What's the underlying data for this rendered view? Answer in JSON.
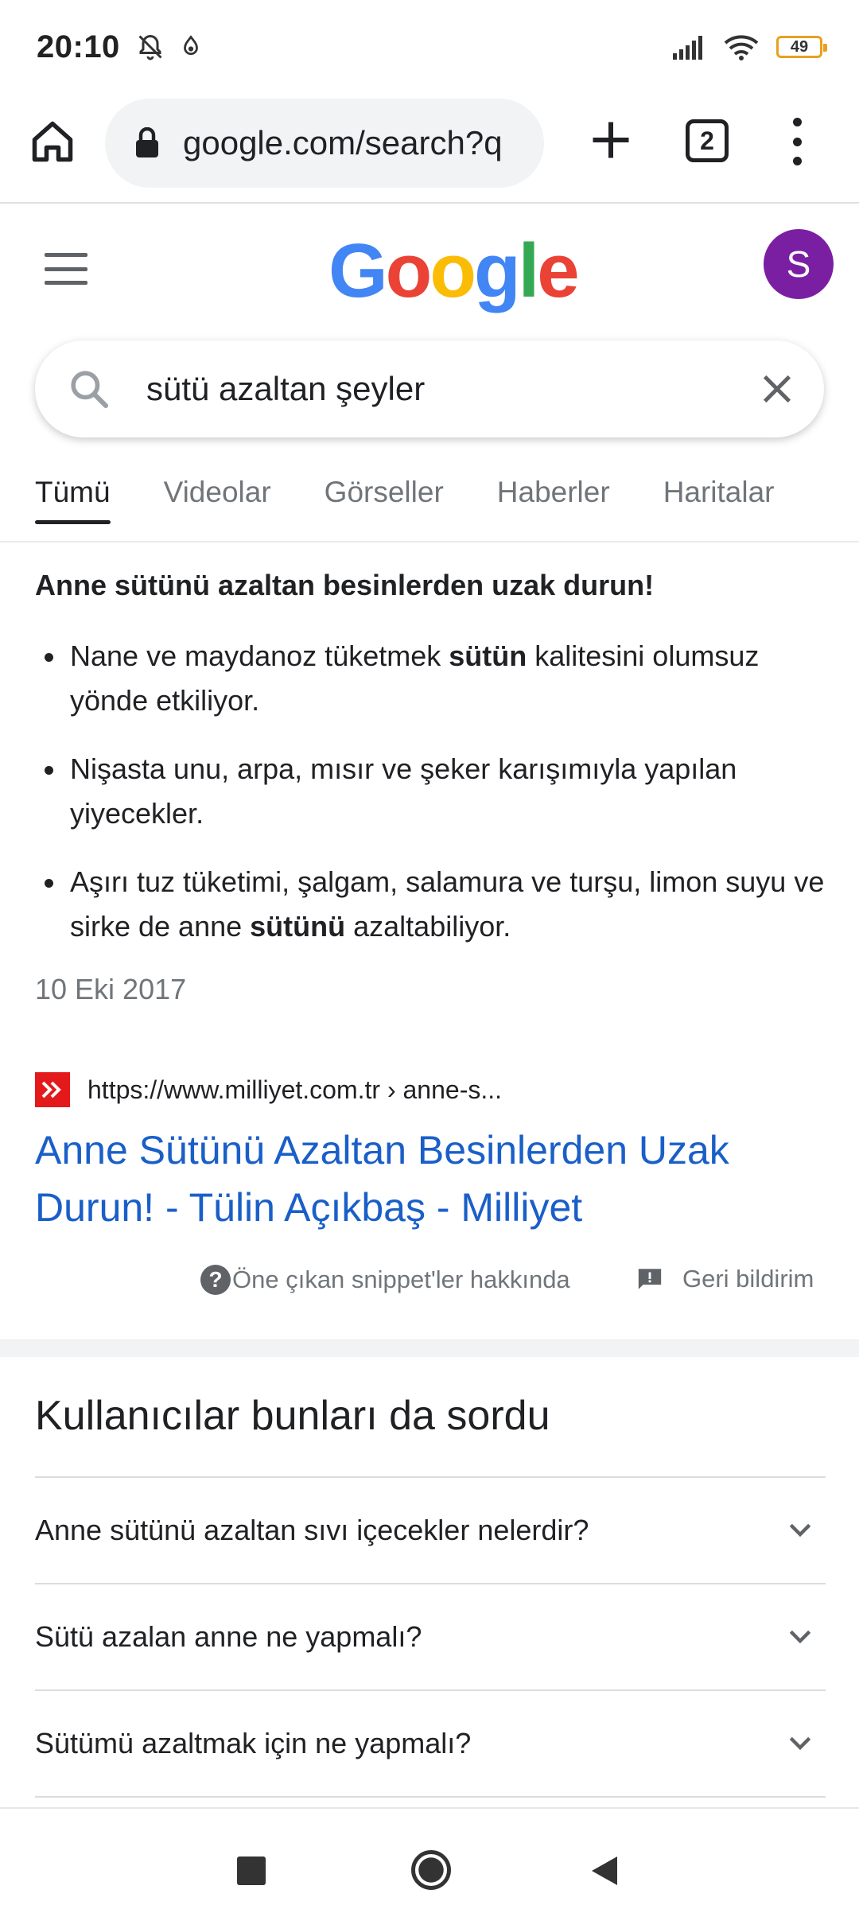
{
  "status_bar": {
    "time": "20:10",
    "battery": "49"
  },
  "browser": {
    "url": "google.com/search?q",
    "tab_count": "2"
  },
  "header": {
    "avatar_letter": "S"
  },
  "search": {
    "query": "sütü azaltan şeyler"
  },
  "tabs": [
    {
      "label": "Tümü",
      "active": true
    },
    {
      "label": "Videolar"
    },
    {
      "label": "Görseller"
    },
    {
      "label": "Haberler"
    },
    {
      "label": "Haritalar"
    }
  ],
  "snippet": {
    "heading": "Anne sütünü azaltan besinlerden uzak durun!",
    "items": [
      {
        "before": "Nane ve maydanoz tüketmek ",
        "bold": "sütün",
        "after": " kalitesini olumsuz yönde etkiliyor."
      },
      {
        "before": "Nişasta unu, arpa, mısır ve şeker karışımıyla yapılan yiyecekler.",
        "bold": "",
        "after": ""
      },
      {
        "before": "Aşırı tuz tüketimi, şalgam, salamura ve turşu, limon suyu ve sirke de anne ",
        "bold": "sütünü",
        "after": " azaltabiliyor."
      }
    ],
    "date": "10 Eki 2017",
    "source_url": "https://www.milliyet.com.tr › anne-s...",
    "source_title": "Anne Sütünü Azaltan Besinlerden Uzak Durun! - Tülin Açıkbaş - Milliyet",
    "about_label": "Öne çıkan snippet'ler hakkında",
    "feedback_label": "Geri bildirim"
  },
  "paa": {
    "title": "Kullanıcılar bunları da sordu",
    "questions": [
      "Anne sütünü azaltan sıvı içecekler nelerdir?",
      "Sütü azalan anne ne yapmalı?",
      "Sütümü azaltmak için ne yapmalı?"
    ]
  },
  "colors": {
    "link": "#1a5fc8",
    "avatar_bg": "#7b1fa2",
    "favicon_bg": "#e3191b"
  }
}
